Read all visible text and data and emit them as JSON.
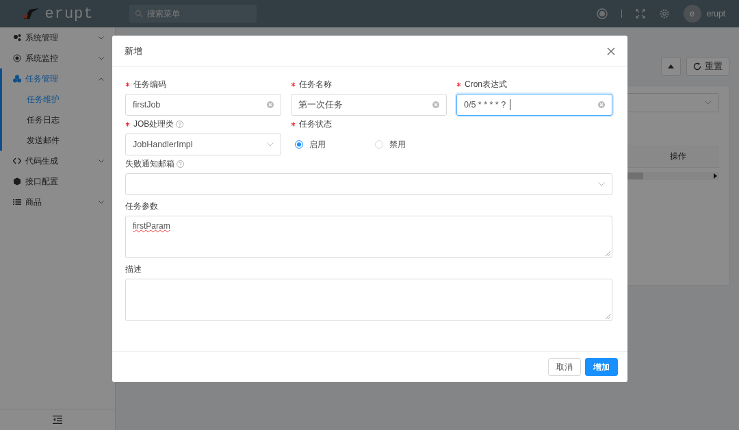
{
  "header": {
    "logo": "erupt",
    "search": {
      "placeholder": "搜索菜单"
    },
    "avatar": "e",
    "user": "erupt"
  },
  "sidebar": {
    "items": [
      {
        "label": "系统管理",
        "expanded": false,
        "selected": false
      },
      {
        "label": "系统监控",
        "expanded": false,
        "selected": false
      },
      {
        "label": "任务管理",
        "expanded": true,
        "selected": true,
        "children": [
          {
            "label": "任务维护",
            "selected": true
          },
          {
            "label": "任务日志",
            "selected": false
          },
          {
            "label": "发送邮件",
            "selected": false
          }
        ]
      },
      {
        "label": "代码生成",
        "expanded": false,
        "selected": false
      },
      {
        "label": "接口配置",
        "selected": false
      },
      {
        "label": "商品",
        "expanded": false,
        "selected": false
      }
    ]
  },
  "toolbar": {
    "buttons": [
      {
        "kind": "collapse"
      },
      {
        "kind": "reset",
        "label": "重置"
      }
    ]
  },
  "table": {
    "columns": [
      "操作"
    ]
  },
  "modal": {
    "title": "新增",
    "fields": [
      {
        "kind": "text",
        "label": "任务编码",
        "required": true,
        "value": "firstJob",
        "focused": false
      },
      {
        "kind": "text",
        "label": "任务名称",
        "required": true,
        "value": "第一次任务",
        "focused": false
      },
      {
        "kind": "text",
        "label": "Cron表达式",
        "required": true,
        "value": "0/5 * * * * ?",
        "focused": true
      },
      {
        "kind": "select",
        "label": "JOB处理类",
        "required": true,
        "help": true,
        "value": "JobHandlerImpl"
      },
      {
        "kind": "radio",
        "label": "任务状态",
        "required": true,
        "options": [
          {
            "label": "启用",
            "selected": true
          },
          {
            "label": "禁用",
            "selected": false
          }
        ]
      },
      {
        "kind": "select",
        "label": "失败通知邮箱",
        "required": false,
        "help": true,
        "wide": true
      },
      {
        "kind": "textarea",
        "label": "任务参数",
        "required": false,
        "value": "firstParam"
      },
      {
        "kind": "textarea",
        "label": "描述",
        "required": false
      }
    ],
    "buttons": [
      {
        "label": "取消",
        "primary": false
      },
      {
        "label": "增加",
        "primary": true
      }
    ]
  }
}
